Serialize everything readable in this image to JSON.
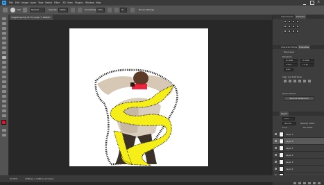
{
  "app": {
    "logo_text": "Ps"
  },
  "menubar": {
    "items": [
      "File",
      "Edit",
      "Image",
      "Layer",
      "Type",
      "Select",
      "Filter",
      "3D",
      "View",
      "Plugins",
      "Window",
      "Help"
    ]
  },
  "options_bar": {
    "size": "100",
    "mode": "Normal",
    "opacity_label": "Opacity:",
    "opacity_value": "100%",
    "flow_label": "Smoothing:",
    "smoothing_value": "10%",
    "angle_value": "0°",
    "brush_label": "Brush Settings"
  },
  "document": {
    "tab_title": "image01.psd @ 33.3% (Layer 7, RGB/8) *"
  },
  "status": {
    "zoom": "33.33%",
    "info": "1080 px x 1080 px (72 ppi)"
  },
  "right_panel": {
    "top_tabs": [
      "Adjustments",
      "Libraries"
    ],
    "mid_tabs": [
      "Character Styles",
      "Properties"
    ],
    "properties_title": "Pixel Layer",
    "transform_label": "Transform",
    "align_label": "Align and Distribute",
    "quick_actions_label": "Quick Actions",
    "quick_action_button": "Remove Background",
    "field_w": "W 1080",
    "field_h": "H 1080",
    "field_x": "X 0 px",
    "field_y": "Y 0 px",
    "field_angle": "0.00°"
  },
  "layers_panel": {
    "title": "Layers",
    "kind_label": "Kind",
    "blend_mode": "Normal",
    "opacity_label": "Opacity: 100%",
    "lock_label": "Lock:",
    "fill_label": "Fill: 100%",
    "layers": [
      {
        "name": "Layer 7",
        "selected": false
      },
      {
        "name": "Layer 6",
        "selected": true
      },
      {
        "name": "Layer 5",
        "selected": false
      },
      {
        "name": "Layer 4",
        "selected": false
      },
      {
        "name": "Layer 3",
        "selected": false
      },
      {
        "name": "Layer 2",
        "selected": false
      },
      {
        "name": "Background",
        "selected": false
      }
    ]
  },
  "colors": {
    "accent": "#31a8ff",
    "foreground_swatch": "#e8102a",
    "background_swatch": "#ffffff",
    "highlight": "#f5ee19"
  }
}
